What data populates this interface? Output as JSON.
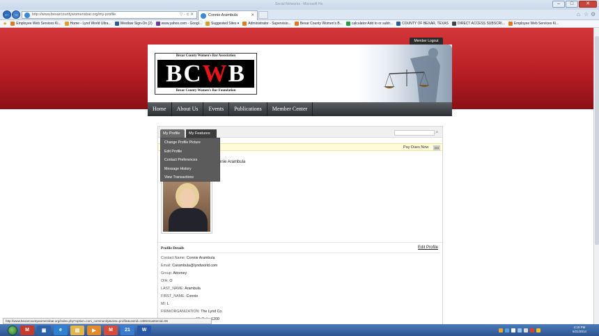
{
  "browser": {
    "window_title": "Social Networks - Microsoft Ho",
    "address": "http://www.bexarcountywomensbar.org/my-profile",
    "address_controls": "▽ - ⊂ ✕",
    "tab_title": "Connie Arambula",
    "favorites": [
      {
        "label": "Employee Web Services Ki...",
        "color": "#e07a20"
      },
      {
        "label": "Home - Lynd World Ultra...",
        "color": "#e0a020"
      },
      {
        "label": "Westlaw Sign-On (2)",
        "color": "#2a5aa0"
      },
      {
        "label": "www.yahoo.com - Googl...",
        "color": "#6a3aa0"
      },
      {
        "label": "Suggested Sites ▾",
        "color": "#d8a020"
      },
      {
        "label": "Administrator - Supervisio...",
        "color": "#e07a20"
      },
      {
        "label": "Bexar County Women's B...",
        "color": "#e07a20"
      },
      {
        "label": "calculator Add to or subtr...",
        "color": "#20a040"
      },
      {
        "label": "COUNTY OF BEXAR, TEXAS",
        "color": "#2a5aa0"
      },
      {
        "label": "DIRECT ACCESS SUBSCRI...",
        "color": "#444444"
      },
      {
        "label": "Employee Web Services Ki...",
        "color": "#e07a20"
      }
    ],
    "status_url": "http://www.bexarcountywomensbar.org/index.php?option=com_community&view=profile&userid=1385311&Itemid=96"
  },
  "site": {
    "member_logout": "Member Logout",
    "logo_top": "Bexar County Women's Bar Association",
    "logo_letters_a": "BC",
    "logo_letter_w": "W",
    "logo_letter_b": "B",
    "logo_bottom": "Bexar County Women's Bar Foundation",
    "nav": [
      "Home",
      "About Us",
      "Events",
      "Publications",
      "Member Center"
    ]
  },
  "profile": {
    "tabs": {
      "my_profile": "My Profile",
      "my_features": "My Features"
    },
    "dropdown": [
      "Change Profile Picture",
      "Edit Profile",
      "Contact Preferences",
      "Message History",
      "View Transactions"
    ],
    "pay_dues": "Pay Dues Now",
    "go": "GO",
    "name": "nnie Arambula",
    "details_title": "Profile Details",
    "edit_profile": "Edit Profile",
    "fields": [
      {
        "label": "Contact Name:",
        "value": "Connie Arambula"
      },
      {
        "label": "Email:",
        "value": "Carambula@lyndworld.com"
      },
      {
        "label": "Group:",
        "value": "Attorney"
      },
      {
        "label": "OIH:",
        "value": "O"
      },
      {
        "label": "LAST_NAME:",
        "value": "Arambula"
      },
      {
        "label": "FIRST_NAME:",
        "value": "Connie"
      },
      {
        "label": "MI:",
        "value": "L"
      },
      {
        "label": "FIRM/ORGANIZATION:",
        "value": "The Lynd Co."
      },
      {
        "label": "",
        "value": "W. Suite 1200"
      }
    ]
  },
  "taskbar": {
    "clock_time": "4:19 PM",
    "clock_date": "6/21/2014",
    "calendar_day": "21"
  },
  "colors": {
    "brand_red": "#c0232a",
    "nav_dark": "#2c3034",
    "dues_bg": "#fdfbd8"
  }
}
